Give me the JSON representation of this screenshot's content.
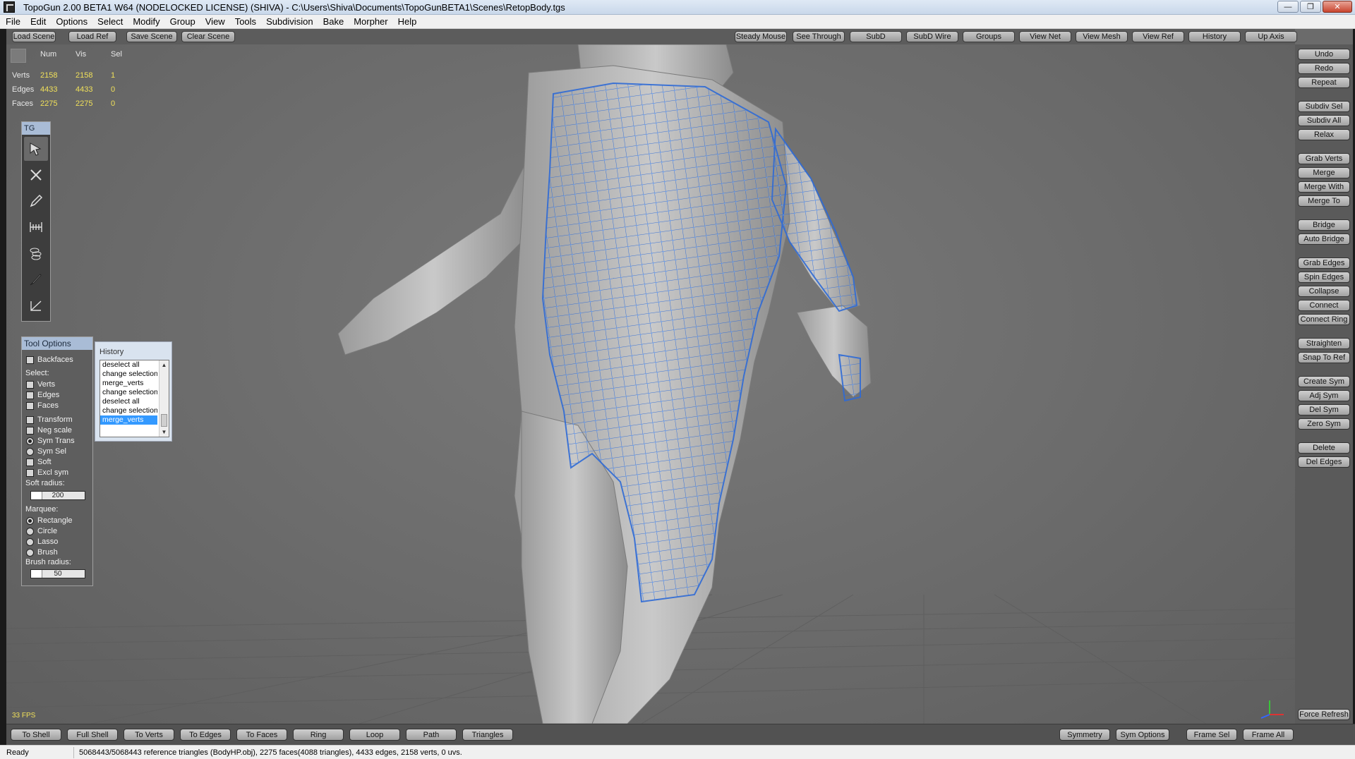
{
  "window": {
    "title": "TopoGun 2.00 BETA1 W64  (NODELOCKED LICENSE) (SHIVA) - C:\\Users\\Shiva\\Documents\\TopoGunBETA1\\Scenes\\RetopBody.tgs",
    "minimize": "—",
    "maximize": "❐",
    "close": "✕"
  },
  "menu": [
    "File",
    "Edit",
    "Options",
    "Select",
    "Modify",
    "Group",
    "View",
    "Tools",
    "Subdivision",
    "Bake",
    "Morpher",
    "Help"
  ],
  "top_toolbar": {
    "left": [
      "Load Scene",
      "Load Ref",
      "Save Scene",
      "Clear Scene"
    ],
    "right": [
      "Steady Mouse",
      "See Through",
      "SubD",
      "SubD Wire",
      "Groups",
      "View Net",
      "View Mesh",
      "View Ref",
      "History",
      "Up Axis"
    ]
  },
  "stats": {
    "headers": [
      "Num",
      "Vis",
      "Sel"
    ],
    "rows": [
      {
        "label": "Verts",
        "num": "2158",
        "vis": "2158",
        "sel": "1"
      },
      {
        "label": "Edges",
        "num": "4433",
        "vis": "4433",
        "sel": "0"
      },
      {
        "label": "Faces",
        "num": "2275",
        "vis": "2275",
        "sel": "0"
      }
    ]
  },
  "tg_panel": {
    "title": "TG",
    "tools": [
      "select-tool-icon",
      "cut-tool-icon",
      "pencil-tool-icon",
      "bridge-tool-icon",
      "tubes-tool-icon",
      "brush-tool-icon",
      "fill-tool-icon"
    ]
  },
  "tool_options": {
    "title": "Tool Options",
    "backfaces": "Backfaces",
    "select_label": "Select:",
    "verts": "Verts",
    "edges": "Edges",
    "faces": "Faces",
    "transform": "Transform",
    "neg_scale": "Neg scale",
    "sym_trans": "Sym Trans",
    "sym_sel": "Sym Sel",
    "soft": "Soft",
    "excl_sym": "Excl sym",
    "soft_radius_label": "Soft radius:",
    "soft_radius_value": "200",
    "marquee_label": "Marquee:",
    "rectangle": "Rectangle",
    "circle": "Circle",
    "lasso": "Lasso",
    "brush": "Brush",
    "brush_radius_label": "Brush radius:",
    "brush_radius_value": "50"
  },
  "history": {
    "title": "History",
    "items": [
      "deselect all",
      "change selection",
      "merge_verts",
      "change selection",
      "deselect all",
      "change selection",
      "merge_verts"
    ],
    "selected_index": 6
  },
  "right_panel": [
    "Undo",
    "Redo",
    "Repeat",
    "Subdiv Sel",
    "Subdiv All",
    "Relax",
    "Grab Verts",
    "Merge",
    "Merge With",
    "Merge To",
    "Bridge",
    "Auto Bridge",
    "Grab Edges",
    "Spin Edges",
    "Collapse",
    "Connect",
    "Connect Ring",
    "Straighten",
    "Snap To Ref",
    "Create Sym",
    "Adj Sym",
    "Del Sym",
    "Zero Sym",
    "Delete",
    "Del Edges",
    "Force Refresh"
  ],
  "fps": "33 FPS",
  "bottom_toolbar": {
    "left": [
      "To Shell",
      "Full Shell",
      "To Verts",
      "To Edges",
      "To Faces",
      "Ring",
      "Loop",
      "Path",
      "Triangles"
    ],
    "right": [
      "Symmetry",
      "Sym Options",
      "Frame Sel",
      "Frame All"
    ]
  },
  "status": {
    "ready": "Ready",
    "info": "5068443/5068443 reference triangles (BodyHP.obj), 2275 faces(4088 triangles), 4433 edges, 2158 verts, 0 uvs."
  },
  "colors": {
    "viewport_bg": "#6b6b6b",
    "mesh_wire": "#2f6bd6",
    "stat_values": "#f0e05a",
    "panel_title": "#a9bcd6"
  }
}
